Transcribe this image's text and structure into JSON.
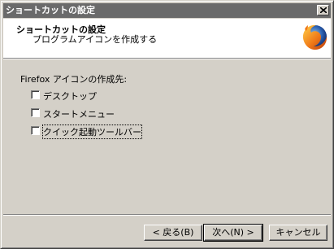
{
  "window": {
    "title": "ショートカットの設定"
  },
  "header": {
    "title": "ショートカットの設定",
    "subtitle": "プログラムアイコンを作成する",
    "logo_icon": "firefox-logo-icon"
  },
  "content": {
    "group_label": "Firefox アイコンの作成先:",
    "options": [
      {
        "label": "デスクトップ",
        "checked": false
      },
      {
        "label": "スタートメニュー",
        "checked": false
      },
      {
        "label": "クイック起動ツールバー",
        "checked": false,
        "focused": true
      }
    ]
  },
  "buttons": {
    "back": "< 戻る(B)",
    "next": "次へ(N) >",
    "cancel": "キャンセル"
  },
  "colors": {
    "dialog_face": "#d4d0c8",
    "titlebar": "#6a6a6a",
    "header_bg": "#ffffff"
  }
}
